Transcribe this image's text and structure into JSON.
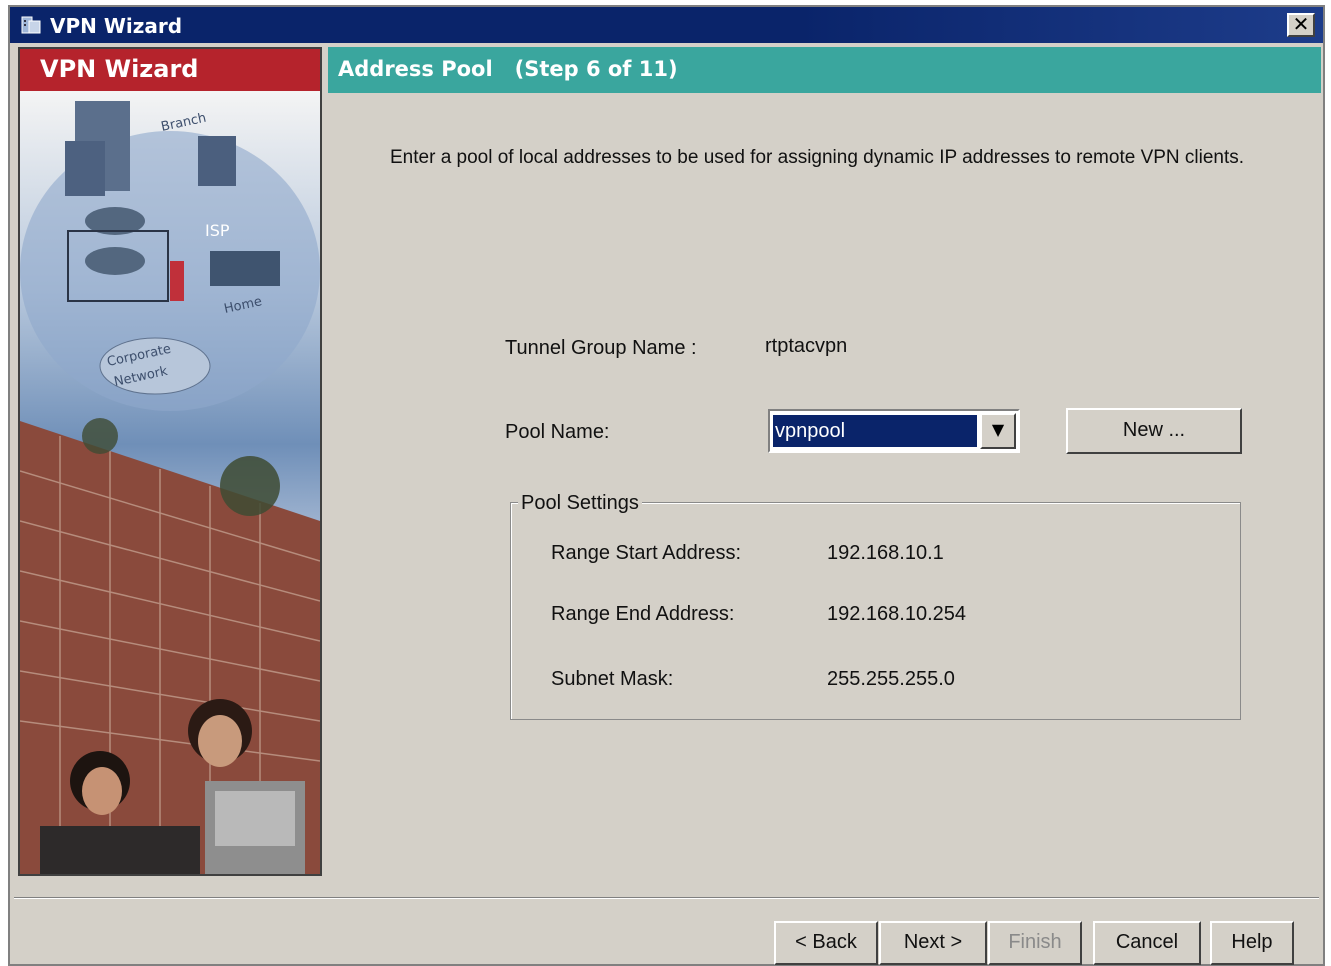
{
  "window": {
    "title": "VPN Wizard",
    "close_label": "✕"
  },
  "sidebar": {
    "header": "VPN Wizard",
    "art_labels": {
      "branch": "Branch",
      "isp": "ISP",
      "home": "Home",
      "corporate": "Corporate",
      "network": "Network"
    }
  },
  "step": {
    "title": "Address Pool   (Step 6 of 11)"
  },
  "main": {
    "instructions": "Enter a pool of local addresses to be used for assigning dynamic IP addresses to remote VPN clients.",
    "tunnel_group": {
      "label": "Tunnel Group Name :",
      "value": "rtptacvpn"
    },
    "pool_name": {
      "label": "Pool Name:",
      "value": "vpnpool"
    },
    "new_button": "New ...",
    "pool_settings": {
      "legend": "Pool Settings",
      "rows": [
        {
          "label": "Range Start Address:",
          "value": "192.168.10.1"
        },
        {
          "label": "Range End Address:",
          "value": "192.168.10.254"
        },
        {
          "label": "Subnet Mask:",
          "value": "255.255.255.0"
        }
      ]
    }
  },
  "footer": {
    "back": "< Back",
    "next": "Next >",
    "finish": "Finish",
    "cancel": "Cancel",
    "help": "Help"
  },
  "colors": {
    "titlebar": "#0a246a",
    "sidebar_header": "#b5232c",
    "step_header": "#3aa69e",
    "dialog": "#d4d0c8",
    "selection": "#0a246a"
  }
}
